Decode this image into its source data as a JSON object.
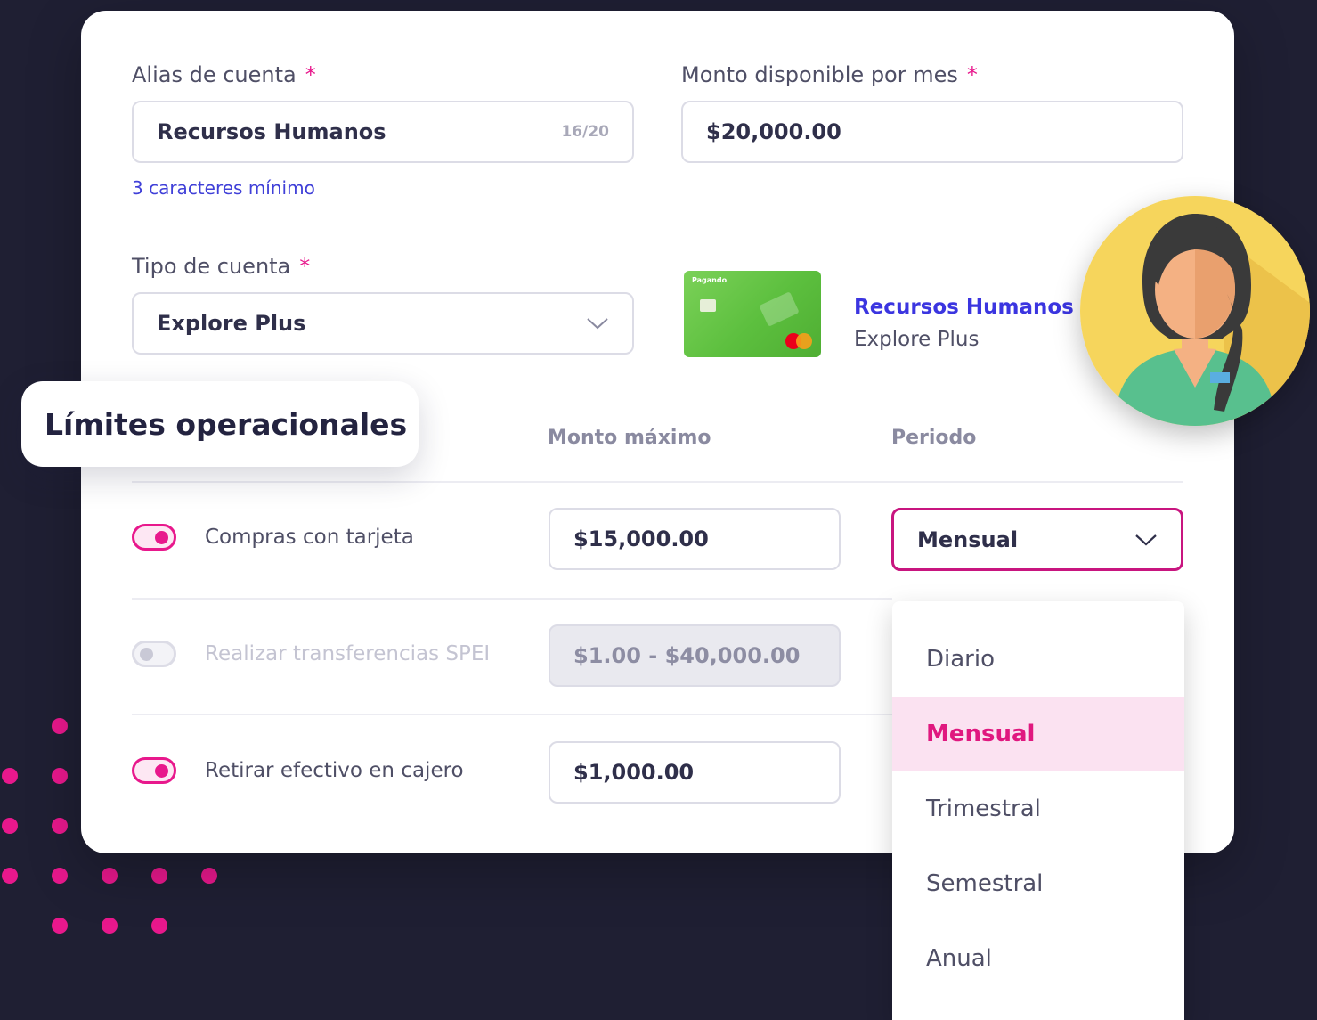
{
  "form": {
    "alias": {
      "label": "Alias de cuenta",
      "required_mark": "*",
      "value": "Recursos Humanos",
      "counter": "16/20",
      "hint": "3 caracteres mínimo"
    },
    "monthly_amount": {
      "label": "Monto disponible por mes",
      "required_mark": "*",
      "value": "$20,000.00"
    },
    "account_type": {
      "label": "Tipo de cuenta",
      "required_mark": "*",
      "value": "Explore Plus"
    }
  },
  "card_preview": {
    "brand": "Pagando",
    "name": "Recursos Humanos",
    "type": "Explore Plus"
  },
  "limits": {
    "title": "Límites operacionales",
    "col_amount": "Monto máximo",
    "col_period": "Periodo",
    "rows": [
      {
        "label": "Compras con tarjeta",
        "amount": "$15,000.00",
        "enabled": true
      },
      {
        "label": "Realizar transferencias SPEI",
        "amount": "$1.00 - $40,000.00",
        "enabled": false
      },
      {
        "label": "Retirar efectivo en cajero",
        "amount": "$1,000.00",
        "enabled": true
      }
    ],
    "period_selected": "Mensual",
    "period_options": [
      "Diario",
      "Mensual",
      "Trimestral",
      "Semestral",
      "Anual"
    ]
  },
  "colors": {
    "accent": "#e8188c",
    "link": "#3b35e0",
    "background": "#1f1f33"
  }
}
